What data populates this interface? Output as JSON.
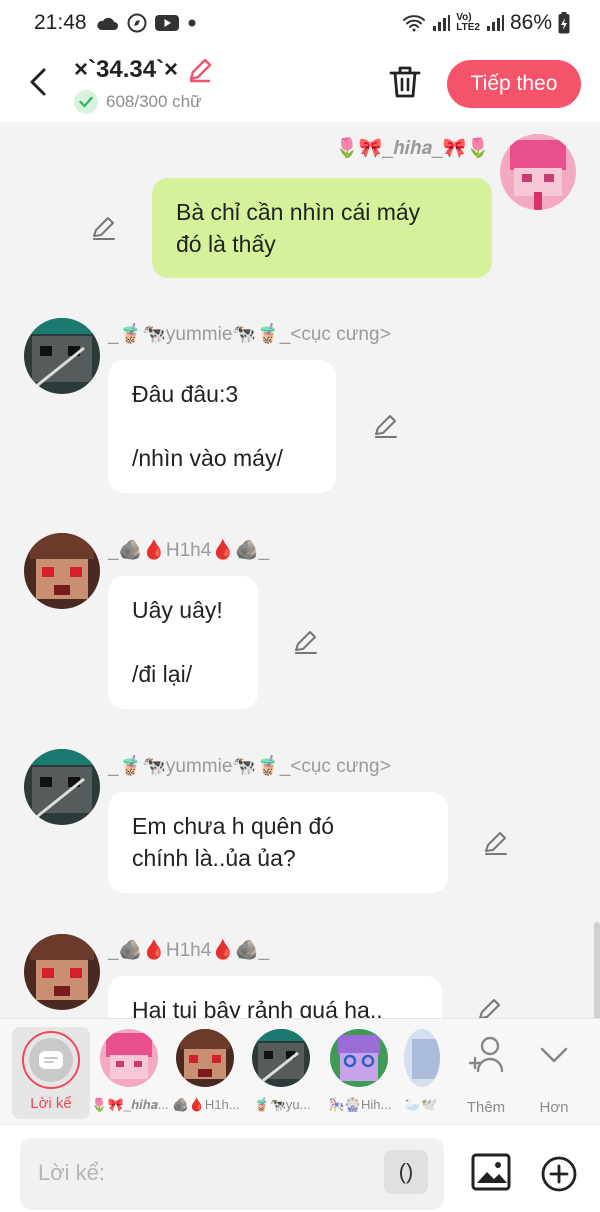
{
  "status_bar": {
    "time": "21:48",
    "battery": "86%",
    "net_top": "Vo)",
    "net_bottom": "LTE2"
  },
  "header": {
    "title": "×`34.34`×",
    "char_count": "608/300 chữ",
    "next_label": "Tiếp theo"
  },
  "messages": [
    {
      "sender": "🌷🎀_𝒉𝒊𝒉𝒂_🎀🌷",
      "text": "Bà chỉ cần nhìn cái máy\nđó là thấy",
      "mine": true
    },
    {
      "sender": "_🧋🐄yummie🐄🧋_<cục cưng>",
      "text": "Đâu đâu:3\n\n/nhìn vào máy/",
      "mine": false
    },
    {
      "sender": "_🪨🩸H1h4🩸🪨_",
      "text": "Uây uây!\n\n/đi lại/",
      "mine": false
    },
    {
      "sender": "_🧋🐄yummie🐄🧋_<cục cưng>",
      "text": "Em chưa h quên đó\nchính là..ủa ủa?",
      "mine": false
    },
    {
      "sender": "_🪨🩸H1h4🩸🪨_",
      "text": "Hai tụi bây rảnh quá ha..",
      "mine": false
    }
  ],
  "characters": {
    "narrator_label": "Lời kể",
    "items": [
      {
        "name": "🌷🎀_𝒉𝒊𝒉𝒂..."
      },
      {
        "name": "🪨🩸H1h..."
      },
      {
        "name": "🧋🐄yu..."
      },
      {
        "name": "🎠🎡Hih..."
      },
      {
        "name": "🦢🕊️"
      }
    ],
    "add_label": "Thêm",
    "more_label": "Hơn"
  },
  "input": {
    "placeholder": "Lời kể:",
    "paren": "()"
  },
  "colors": {
    "accent": "#f5536a",
    "my_bubble": "#d5f29a",
    "narrator_ring": "#f0485b"
  }
}
